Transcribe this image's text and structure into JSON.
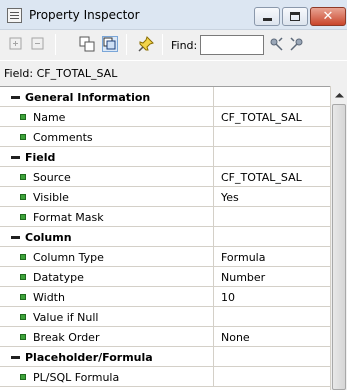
{
  "window": {
    "title": "Property Inspector",
    "close_glyph": "✕"
  },
  "toolbar": {
    "find_label": "Find:",
    "find_value": ""
  },
  "field": {
    "label": "Field: CF_TOTAL_SAL"
  },
  "rows": [
    {
      "type": "section",
      "label": "General Information",
      "value": ""
    },
    {
      "type": "property",
      "label": "Name",
      "value": "CF_TOTAL_SAL"
    },
    {
      "type": "property",
      "label": "Comments",
      "value": ""
    },
    {
      "type": "section",
      "label": "Field",
      "value": ""
    },
    {
      "type": "property",
      "label": "Source",
      "value": "CF_TOTAL_SAL"
    },
    {
      "type": "property",
      "label": "Visible",
      "value": "Yes"
    },
    {
      "type": "property",
      "label": "Format Mask",
      "value": ""
    },
    {
      "type": "section",
      "label": "Column",
      "value": ""
    },
    {
      "type": "property",
      "label": "Column Type",
      "value": "Formula"
    },
    {
      "type": "property",
      "label": "Datatype",
      "value": "Number"
    },
    {
      "type": "property",
      "label": "Width",
      "value": "10"
    },
    {
      "type": "property",
      "label": "Value if Null",
      "value": ""
    },
    {
      "type": "property",
      "label": "Break Order",
      "value": "None"
    },
    {
      "type": "section",
      "label": "Placeholder/Formula",
      "value": ""
    },
    {
      "type": "property",
      "label": "PL/SQL Formula",
      "value": ""
    }
  ],
  "icons": {
    "app": "property-inspector-icon",
    "expand": "expand-icon",
    "collapse": "collapse-icon",
    "copy": "copy-properties-icon",
    "paste": "paste-properties-icon",
    "pin": "pin-icon",
    "find_next": "find-next-icon",
    "find_prev": "find-previous-icon"
  }
}
